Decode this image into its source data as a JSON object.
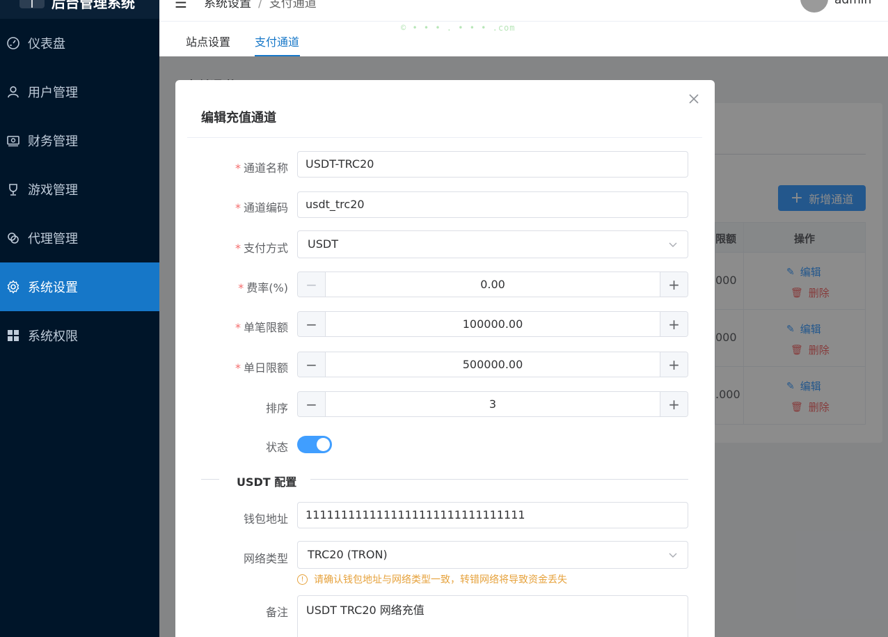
{
  "sidebar": {
    "logo_glyph": "I",
    "logo_text": "后台管理系统",
    "items": [
      {
        "label": "仪表盘",
        "icon": "dashboard-icon"
      },
      {
        "label": "用户管理",
        "icon": "user-icon"
      },
      {
        "label": "财务管理",
        "icon": "finance-icon"
      },
      {
        "label": "游戏管理",
        "icon": "trophy-icon"
      },
      {
        "label": "代理管理",
        "icon": "agent-icon"
      },
      {
        "label": "系统设置",
        "icon": "gear-icon",
        "active": true
      },
      {
        "label": "系统权限",
        "icon": "grid-icon"
      }
    ]
  },
  "header": {
    "breadcrumb_root": "系统设置",
    "breadcrumb_sep": "/",
    "breadcrumb_current": "支付通道",
    "username": "admin"
  },
  "tabs": [
    {
      "label": "站点设置",
      "active": false
    },
    {
      "label": "支付通道",
      "active": true
    }
  ],
  "watermark": "© • • • . • • • .com",
  "background": {
    "page_title": "支付通道",
    "add_button": "新增通道",
    "table_headers": {
      "limit": "限额",
      "actions": "操作"
    },
    "rows": [
      {
        "amount": "000",
        "edit": "编辑",
        "delete": "删除"
      },
      {
        "amount": "000",
        "edit": "编辑",
        "delete": "删除"
      },
      {
        "amount": ".000",
        "edit": "编辑",
        "delete": "删除"
      }
    ]
  },
  "dialog": {
    "title": "编辑充值通道",
    "fields": {
      "name": {
        "label": "通道名称",
        "value": "USDT-TRC20",
        "required": true
      },
      "code": {
        "label": "通道编码",
        "value": "usdt_trc20",
        "required": true
      },
      "method": {
        "label": "支付方式",
        "value": "USDT",
        "required": true
      },
      "fee": {
        "label": "费率(%)",
        "value": "0.00",
        "required": true
      },
      "single_limit": {
        "label": "单笔限额",
        "value": "100000.00",
        "required": true
      },
      "daily_limit": {
        "label": "单日限额",
        "value": "500000.00",
        "required": true
      },
      "sort": {
        "label": "排序",
        "value": "3"
      },
      "status": {
        "label": "状态",
        "enabled": true
      }
    },
    "usdt_section": {
      "title": "USDT 配置",
      "wallet": {
        "label": "钱包地址",
        "value": "1111111111111111111111111111111"
      },
      "network": {
        "label": "网络类型",
        "value": "TRC20 (TRON)"
      },
      "warning": "请确认钱包地址与网络类型一致，转错网络将导致资金丢失",
      "remark": {
        "label": "备注",
        "value": "USDT TRC20 网络充值"
      }
    }
  },
  "colors": {
    "sidebar_bg": "#001529",
    "active_menu": "#1677c8",
    "primary": "#409eff",
    "danger": "#f56c6c",
    "warning": "#e6a23c"
  }
}
